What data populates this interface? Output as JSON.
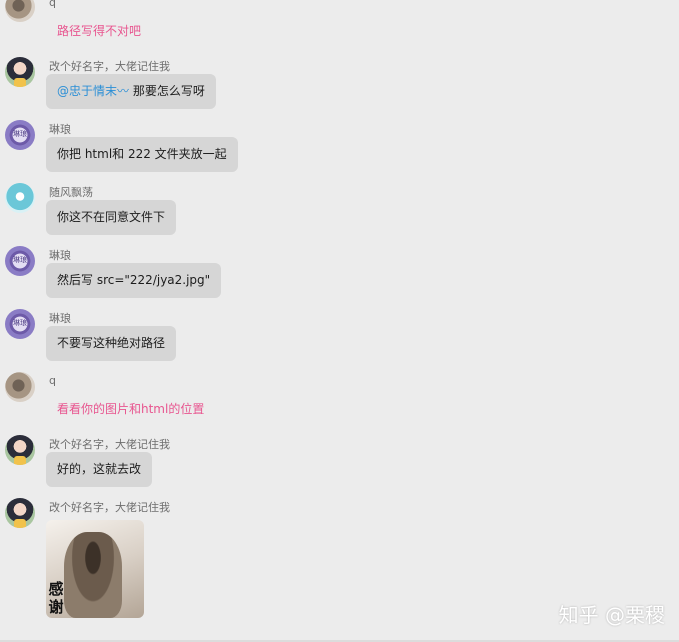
{
  "messages": [
    {
      "name": "q",
      "text": "路径写得不对吧",
      "style": "pink"
    },
    {
      "name": "改个好名字，大佬记住我",
      "mention": "@忠于情末〰 ",
      "text": "那要怎么写呀"
    },
    {
      "name": "琳琅",
      "text": "你把 html和 222 文件夹放一起"
    },
    {
      "name": "随风飘荡",
      "text": "你这不在同意文件下"
    },
    {
      "name": "琳琅",
      "text": "然后写 src=\"222/jya2.jpg\""
    },
    {
      "name": "琳琅",
      "text": "不要写这种绝对路径"
    },
    {
      "name": "q",
      "text": "看看你的图片和html的位置",
      "style": "pink"
    },
    {
      "name": "改个好名字，大佬记住我",
      "text": "好的，这就去改"
    },
    {
      "name": "改个好名字，大佬记住我",
      "sticker_text": "感谢"
    }
  ],
  "avatar_badge": "琳琅",
  "watermark": "知乎 @栗稷"
}
